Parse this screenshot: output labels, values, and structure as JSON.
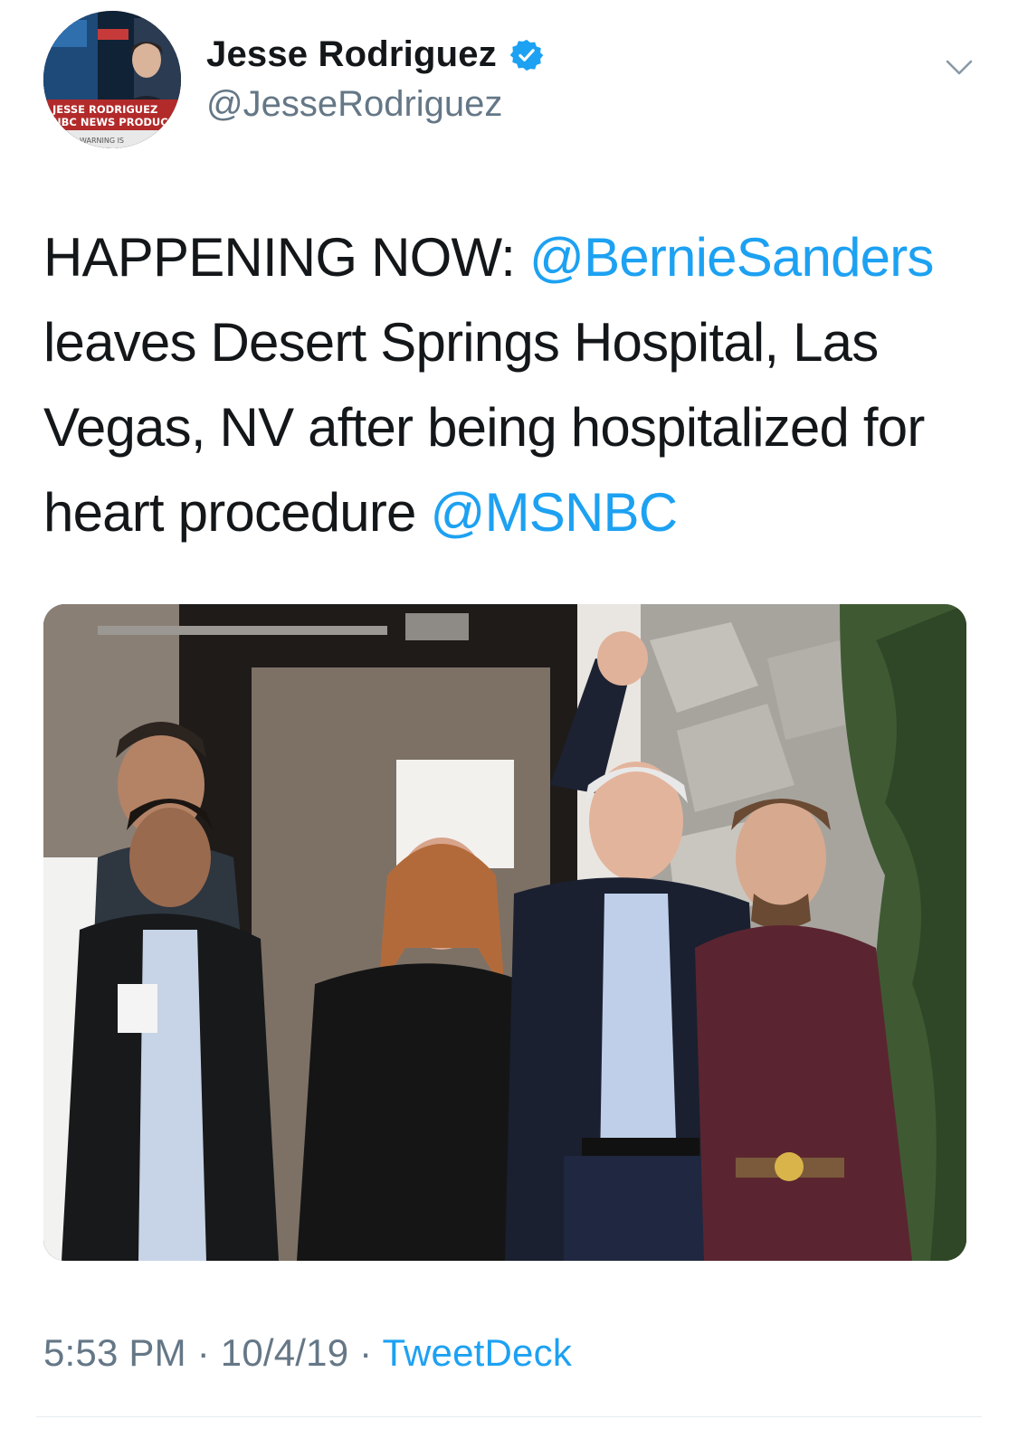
{
  "author": {
    "display_name": "Jesse Rodriguez",
    "handle": "@JesseRodriguez",
    "verified": true,
    "avatar_caption_line1": "JESSE RODRIGUEZ",
    "avatar_caption_line2": "NBC NEWS PRODUCER",
    "avatar_ticker": "WARNING IS"
  },
  "tweet": {
    "text_prefix": "HAPPENING NOW: ",
    "mention1": "@BernieSanders",
    "text_body": " leaves Desert Springs Hospital, Las Vegas, NV after being hospitalized for heart procedure ",
    "mention2": "@MSNBC"
  },
  "meta": {
    "time": "5:53 PM",
    "separator": " · ",
    "date": "10/4/19",
    "source": "TweetDeck"
  },
  "icons": {
    "verified": "verified-badge-icon",
    "menu": "chevron-down-icon"
  },
  "colors": {
    "link": "#1da1f2",
    "secondary_text": "#657786",
    "primary_text": "#14171a"
  }
}
